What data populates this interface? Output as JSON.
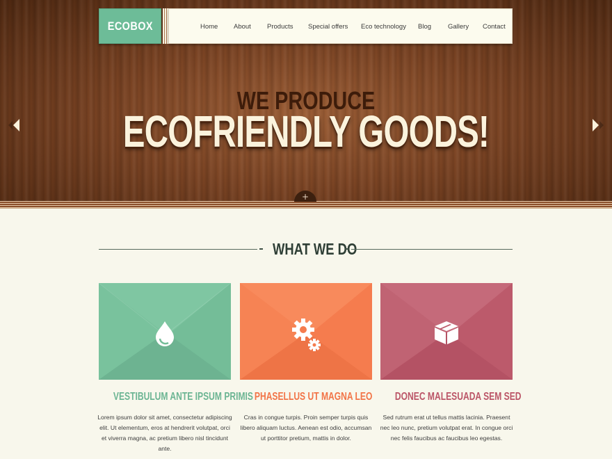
{
  "brand": {
    "logo_text": "ECOBOX"
  },
  "nav": {
    "items": [
      {
        "label": "Home"
      },
      {
        "label": "About"
      },
      {
        "label": "Products"
      },
      {
        "label": "Special offers"
      },
      {
        "label": "Eco technology"
      },
      {
        "label": "Blog"
      },
      {
        "label": "Gallery"
      },
      {
        "label": "Contact"
      }
    ]
  },
  "hero": {
    "line1": "WE PRODUCE",
    "line2": "ECOFRIENDLY GOODS!",
    "prev_icon": "arrow-left-icon",
    "next_icon": "arrow-right-icon",
    "expand_label": "+"
  },
  "section": {
    "title": "WHAT WE DO"
  },
  "cards": [
    {
      "icon": "water-drop-icon",
      "color": "#74bd98",
      "title": "VESTIBULUM ANTE IPSUM PRIMIS",
      "title_color": "#6cb593",
      "text": "Lorem ipsum dolor sit amet, consectetur adipiscing elit. Ut elementum, eros at hendrerit volutpat, orci et viverra magna, ac pretium libero nisl tincidunt ante."
    },
    {
      "icon": "gears-icon",
      "color": "#f57c4e",
      "title": "PHASELLUS UT MAGNA LEO",
      "title_color": "#f27447",
      "text": "Cras in congue turpis. Proin semper turpis quis libero aliquam luctus. Aenean est odio, accumsan ut porttitor pretium, mattis in dolor."
    },
    {
      "icon": "box-icon",
      "color": "#bc5a6b",
      "title": "DONEC MALESUADA SEM SED",
      "title_color": "#bb5567",
      "text": "Sed rutrum erat ut tellus mattis lacinia. Praesent nec leo nunc, pretium volutpat erat. In congue orci nec felis faucibus ac faucibus leo egestas."
    }
  ]
}
